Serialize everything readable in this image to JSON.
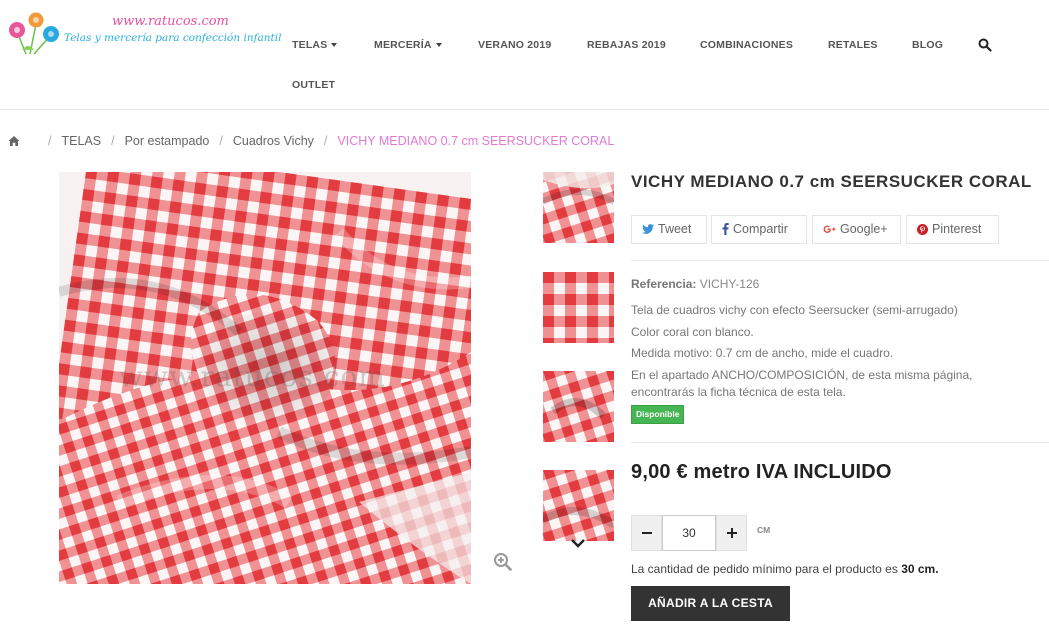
{
  "brand": {
    "url": "www.ratucos.com",
    "tagline": "Telas y mercería para confección infantil"
  },
  "nav": {
    "items": [
      {
        "label": "TELAS",
        "dropdown": true
      },
      {
        "label": "MERCERÍA",
        "dropdown": true
      },
      {
        "label": "VERANO 2019",
        "dropdown": false
      },
      {
        "label": "REBAJAS 2019",
        "dropdown": false
      },
      {
        "label": "COMBINACIONES",
        "dropdown": false
      },
      {
        "label": "RETALES",
        "dropdown": false
      },
      {
        "label": "BLOG",
        "dropdown": false
      },
      {
        "label": "OUTLET",
        "dropdown": false
      }
    ],
    "search_icon": "search-icon"
  },
  "breadcrumb": {
    "home_icon": "home-icon",
    "items": [
      "TELAS",
      "Por estampado",
      "Cuadros Vichy"
    ],
    "current": "VICHY MEDIANO 0.7 cm SEERSUCKER CORAL"
  },
  "gallery": {
    "watermark": "www.ratucos.com",
    "zoom_icon": "zoom-in-icon",
    "thumb_count": 4,
    "thumbs_down_icon": "chevron-down-icon"
  },
  "product": {
    "title": "VICHY MEDIANO 0.7 cm SEERSUCKER CORAL",
    "share": [
      {
        "label": "Tweet",
        "icon": "twitter-icon"
      },
      {
        "label": "Compartir",
        "icon": "facebook-icon"
      },
      {
        "label": "Google+",
        "icon": "google-plus-icon"
      },
      {
        "label": "Pinterest",
        "icon": "pinterest-icon"
      }
    ],
    "reference_label": "Referencia:",
    "reference_value": "VICHY-126",
    "description": [
      "Tela de cuadros vichy con efecto Seersucker (semi-arrugado)",
      "Color coral con blanco.",
      "Medida motivo: 0.7 cm de ancho, mide el cuadro.",
      "En el apartado ANCHO/COMPOSICIÓN, de esta misma página,",
      "encontrarás la ficha técnica de esta tela."
    ],
    "availability": "Disponible",
    "price": "9,00 € metro IVA INCLUIDO",
    "quantity": "30",
    "quantity_unit": "CM",
    "min_note_prefix": "La cantidad de pedido mínimo para el producto es",
    "min_note_value": "30 cm.",
    "add_to_cart": "AÑADIR A LA CESTA"
  },
  "colors": {
    "accent_pink": "#e27ad3",
    "gingham_red": "#e8484a",
    "available_green": "#46b553",
    "button_dark": "#333333"
  }
}
